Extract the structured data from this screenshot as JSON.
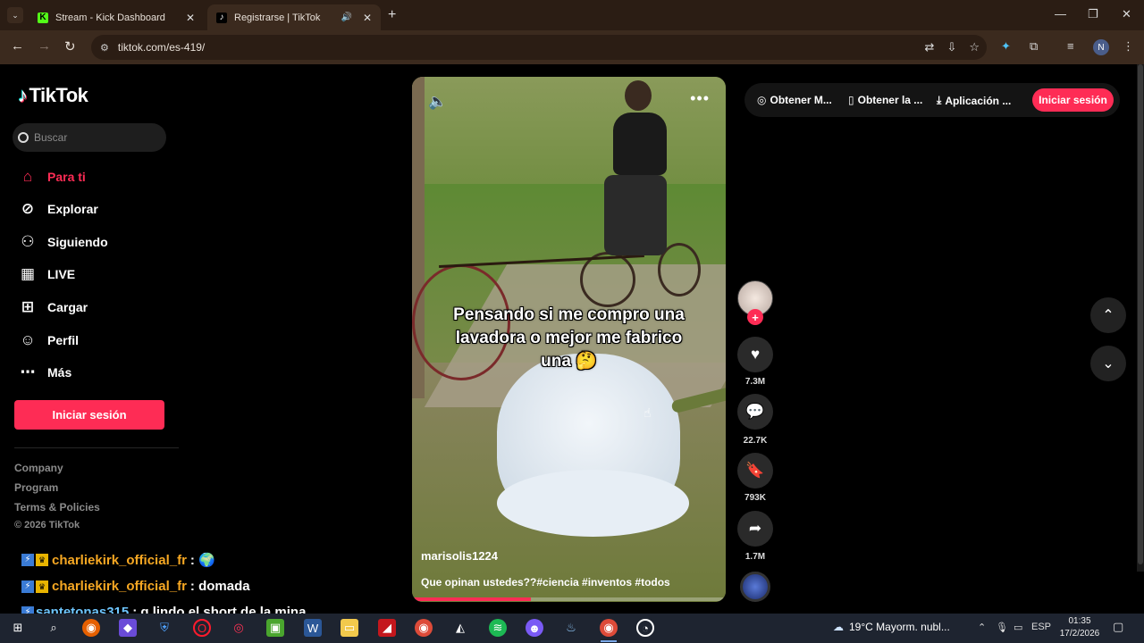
{
  "browser": {
    "tabs": [
      {
        "title": "Stream - Kick Dashboard",
        "favicon": "K"
      },
      {
        "title": "Registrarse | TikTok",
        "favicon": "♪"
      }
    ],
    "url": "tiktok.com/es-419/",
    "profile_initial": "N"
  },
  "sidebar": {
    "logo": "TikTok",
    "search_placeholder": "Buscar",
    "nav": [
      {
        "label": "Para ti",
        "icon": "home-icon"
      },
      {
        "label": "Explorar",
        "icon": "compass-icon"
      },
      {
        "label": "Siguiendo",
        "icon": "following-icon"
      },
      {
        "label": "LIVE",
        "icon": "live-icon"
      },
      {
        "label": "Cargar",
        "icon": "upload-icon"
      },
      {
        "label": "Perfil",
        "icon": "profile-icon"
      },
      {
        "label": "Más",
        "icon": "more-icon"
      }
    ],
    "login_button": "Iniciar sesión",
    "footer": [
      "Company",
      "Program",
      "Terms & Policies"
    ],
    "copyright": "© 2026 TikTok"
  },
  "chat": [
    {
      "user": "charliekirk_official_fr",
      "message": ": 🌍"
    },
    {
      "user": "charliekirk_official_fr",
      "message": ": domada"
    },
    {
      "user": "santetonas315",
      "message": ": q lindo el short de la mina"
    }
  ],
  "video": {
    "caption": "Pensando si me compro una lavadora o mejor me fabrico una 🤔",
    "username": "marisolis1224",
    "description": "Que opinan ustedes??#ciencia #inventos #todos",
    "progress": 0.38
  },
  "actions": {
    "likes": "7.3M",
    "comments": "22.7K",
    "saves": "793K",
    "shares": "1.7M"
  },
  "header": {
    "links": [
      "Obtener M...",
      "Obtener la ...",
      "Aplicación ..."
    ],
    "login": "Iniciar sesión"
  },
  "taskbar": {
    "weather": "19°C  Mayorm. nubl...",
    "lang": "ESP",
    "time": "01:35",
    "date": "17/2/2026"
  },
  "colors": {
    "accent": "#fe2c55",
    "chrome_frame": "#2b1d14"
  }
}
